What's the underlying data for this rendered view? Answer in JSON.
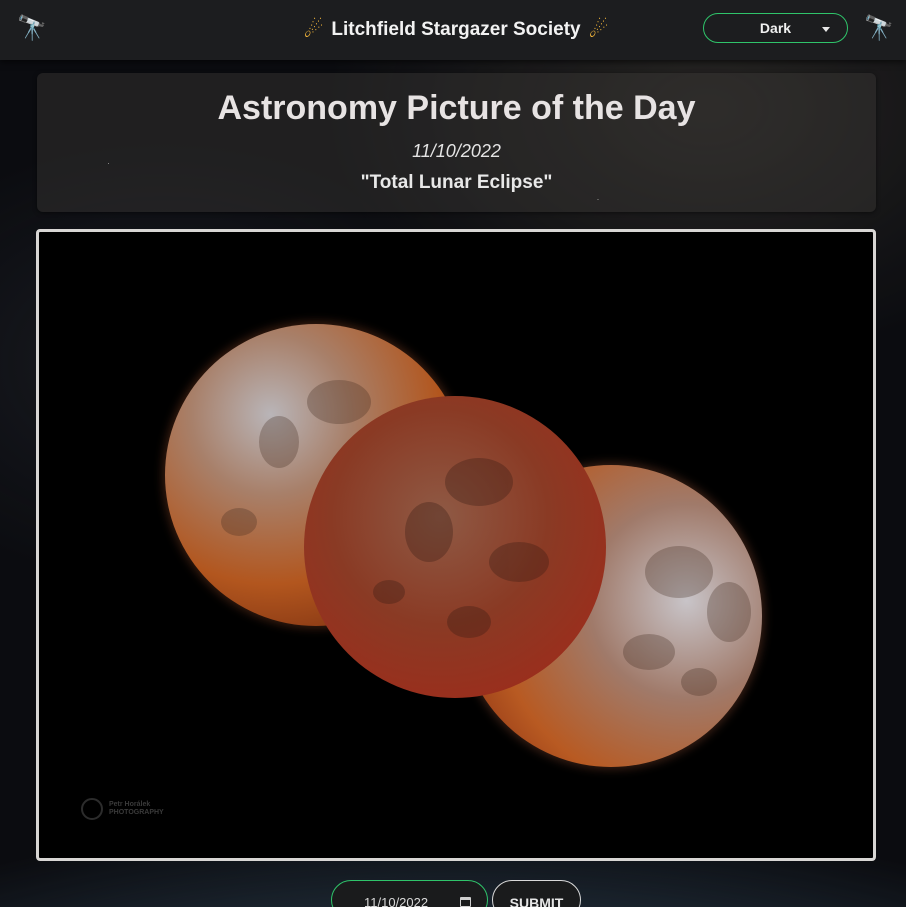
{
  "header": {
    "brand_title": "Litchfield Stargazer Society",
    "left_icon": "telescope-icon",
    "right_icon": "telescope-icon",
    "brand_icon_left": "comet-icon",
    "brand_icon_right": "comet-icon",
    "theme_select": {
      "selected": "Dark"
    },
    "accent_color": "#2fc46a"
  },
  "apod": {
    "heading": "Astronomy Picture of the Day",
    "date": "11/10/2022",
    "title": "\"Total Lunar Eclipse\"",
    "image": {
      "subject": "total lunar eclipse composite of three moons",
      "watermark_line1": "Petr Horálek",
      "watermark_line2": "PHOTOGRAPHY"
    }
  },
  "controls": {
    "date_value": "11/10/2022",
    "date_icon": "calendar-icon",
    "submit_label": "SUBMIT"
  }
}
